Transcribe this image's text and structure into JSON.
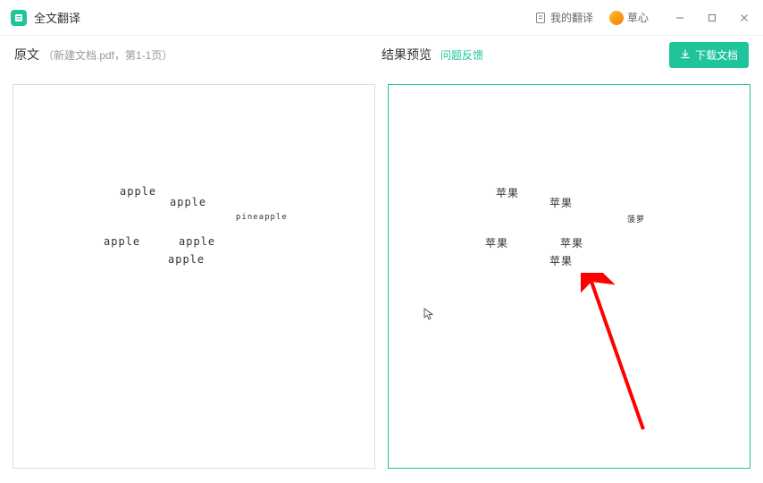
{
  "app": {
    "title": "全文翻译"
  },
  "titlebar": {
    "my_translations": "我的翻译",
    "username": "草心"
  },
  "header": {
    "source_title": "原文",
    "source_sub": "（新建文档.pdf，第1-1页）",
    "preview_title": "结果预览",
    "feedback": "问题反馈",
    "download": "下载文档"
  },
  "source_words": {
    "w1": "apple",
    "w2": "apple",
    "w3": "pineapple",
    "w4": "apple",
    "w5": "apple",
    "w6": "apple"
  },
  "preview_words": {
    "w1": "苹果",
    "w2": "苹果",
    "w3": "菠萝",
    "w4": "苹果",
    "w5": "苹果",
    "w6": "苹果"
  }
}
